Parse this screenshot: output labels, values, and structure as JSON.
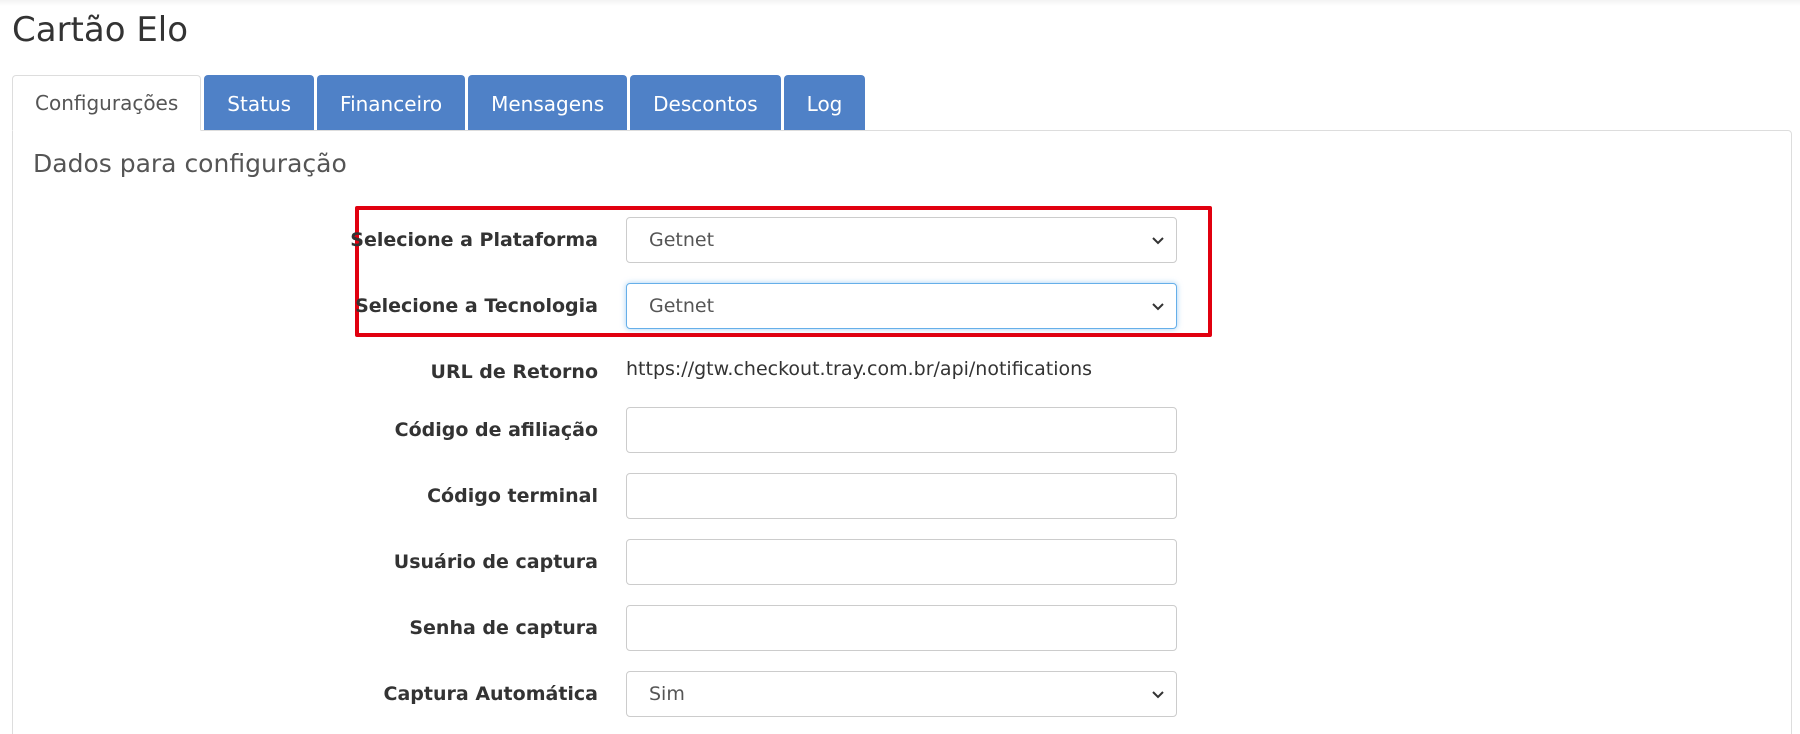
{
  "page": {
    "title": "Cartão Elo"
  },
  "tabs": [
    {
      "label": "Configurações",
      "active": true
    },
    {
      "label": "Status",
      "active": false
    },
    {
      "label": "Financeiro",
      "active": false
    },
    {
      "label": "Mensagens",
      "active": false
    },
    {
      "label": "Descontos",
      "active": false
    },
    {
      "label": "Log",
      "active": false
    }
  ],
  "section": {
    "title": "Dados para configuração"
  },
  "form": {
    "plataforma": {
      "label": "Selecione a Plataforma",
      "value": "Getnet"
    },
    "tecnologia": {
      "label": "Selecione a Tecnologia",
      "value": "Getnet"
    },
    "url_retorno": {
      "label": "URL de Retorno",
      "value": "https://gtw.checkout.tray.com.br/api/notifications"
    },
    "codigo_afiliacao": {
      "label": "Código de afiliação",
      "value": ""
    },
    "codigo_terminal": {
      "label": "Código terminal",
      "value": ""
    },
    "usuario_captura": {
      "label": "Usuário de captura",
      "value": ""
    },
    "senha_captura": {
      "label": "Senha de captura",
      "value": ""
    },
    "captura_automatica": {
      "label": "Captura Automática",
      "value": "Sim"
    }
  },
  "colors": {
    "tab_blue": "#4f81c7",
    "highlight_red": "#e1000f",
    "focus_blue": "#66afe9"
  },
  "icons": {
    "select_arrow": "chevron-down-icon"
  }
}
